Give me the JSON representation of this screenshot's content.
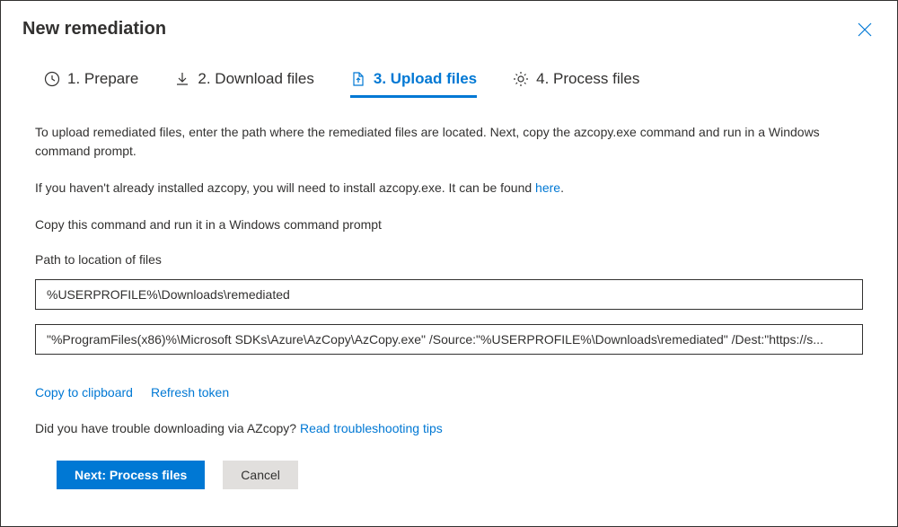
{
  "dialog": {
    "title": "New remediation"
  },
  "tabs": {
    "prepare": "1. Prepare",
    "download": "2. Download files",
    "upload": "3. Upload files",
    "process": "4. Process files"
  },
  "content": {
    "intro": "To upload remediated files, enter the path where the remediated files are located. Next, copy the azcopy.exe command and run in a Windows command prompt.",
    "install_prefix": "If you haven't already installed azcopy, you will need to install azcopy.exe. It can be found ",
    "install_link": "here",
    "install_suffix": ".",
    "copy_instruction": "Copy this command and run it in a Windows command prompt",
    "path_label": "Path to location of files",
    "path_value": "%USERPROFILE%\\Downloads\\remediated",
    "command_value": "\"%ProgramFiles(x86)%\\Microsoft SDKs\\Azure\\AzCopy\\AzCopy.exe\" /Source:\"%USERPROFILE%\\Downloads\\remediated\" /Dest:\"https://s...",
    "copy_clipboard": "Copy to clipboard",
    "refresh_token": "Refresh token",
    "trouble_prefix": "Did you have trouble downloading via AZcopy? ",
    "trouble_link": "Read troubleshooting tips"
  },
  "buttons": {
    "next": "Next: Process files",
    "cancel": "Cancel"
  }
}
